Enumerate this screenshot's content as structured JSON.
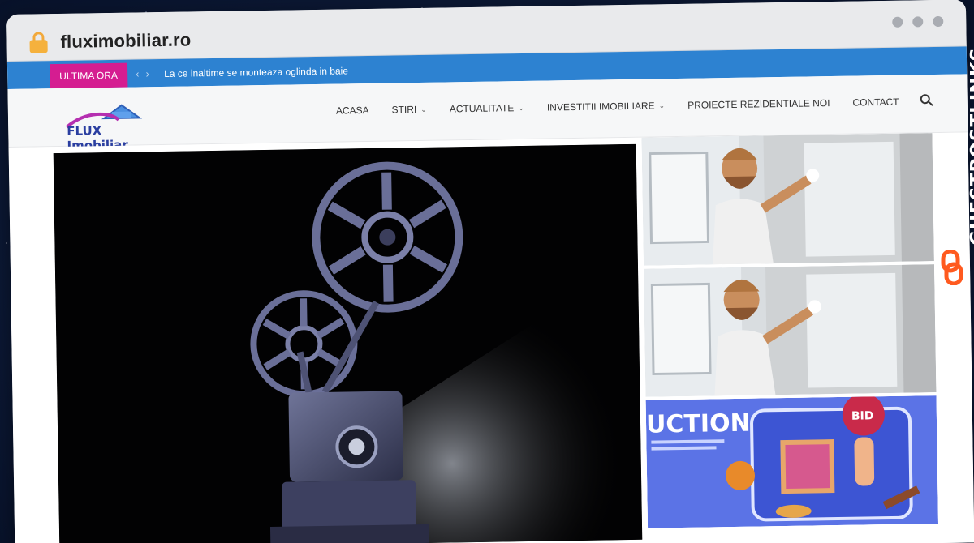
{
  "browser": {
    "url": "fluximobiliar.ro"
  },
  "ticker": {
    "badge": "ULTIMA ORA",
    "headline": "La ce inaltime se monteaza oglinda in baie"
  },
  "site": {
    "logo_text": "FLUX Imobiliar",
    "menu": [
      {
        "label": "ACASA",
        "has_dropdown": false
      },
      {
        "label": "STIRI",
        "has_dropdown": true
      },
      {
        "label": "ACTUALITATE",
        "has_dropdown": true
      },
      {
        "label": "INVESTITII IMOBILIARE",
        "has_dropdown": true
      },
      {
        "label": "PROIECTE REZIDENTIALE NOI",
        "has_dropdown": false
      },
      {
        "label": "CONTACT",
        "has_dropdown": false
      }
    ]
  },
  "featured": {
    "auction_heading": "UCTION",
    "bid_label": "BID"
  },
  "watermark": {
    "text": "GUESTPOSTLINKS"
  },
  "colors": {
    "ticker_bar": "#2d82d1",
    "badge": "#d51d91",
    "brand": "#2a3ea0",
    "watermark": "#ff5a1f"
  }
}
